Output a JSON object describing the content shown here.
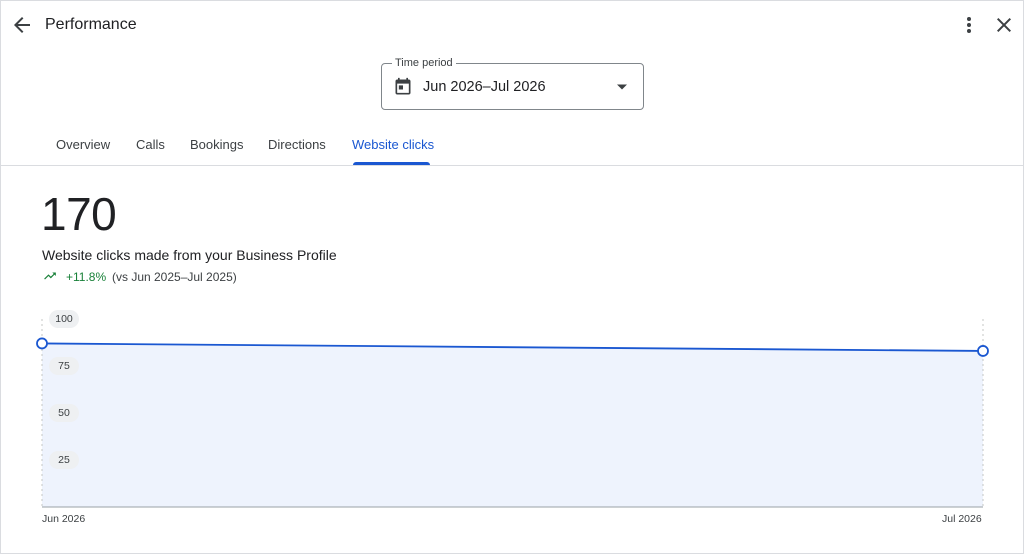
{
  "header": {
    "title": "Performance",
    "back_icon": "arrow-left-icon",
    "more_icon": "more-vert-icon",
    "close_icon": "close-icon"
  },
  "time_period": {
    "label": "Time period",
    "value": "Jun 2026–Jul 2026",
    "icon": "calendar-icon"
  },
  "tabs": [
    {
      "label": "Overview",
      "active": false
    },
    {
      "label": "Calls",
      "active": false
    },
    {
      "label": "Bookings",
      "active": false
    },
    {
      "label": "Directions",
      "active": false
    },
    {
      "label": "Website clicks",
      "active": true
    }
  ],
  "metric": {
    "value": "170",
    "description": "Website clicks made from your Business Profile",
    "trend": "+11.8%",
    "comparison": "(vs Jun 2025–Jul 2025)",
    "trend_icon": "trending-up-icon"
  },
  "colors": {
    "accent": "#1a57d1",
    "positive": "#188038",
    "area_fill": "#eef3fd"
  },
  "chart_data": {
    "type": "area",
    "x": [
      "Jun 2026",
      "Jul 2026"
    ],
    "values": [
      87,
      83
    ],
    "yticks": [
      "100",
      "75",
      "50",
      "25"
    ],
    "ylim": [
      0,
      100
    ],
    "grid": false
  }
}
